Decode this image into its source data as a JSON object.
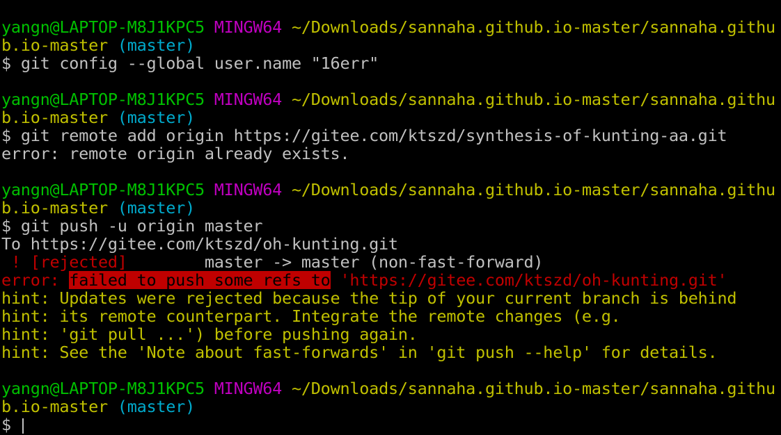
{
  "terminal": {
    "sessions": [
      {
        "user": "yangn@LAPTOP-M8J1KPC5",
        "system": "MINGW64",
        "path_part1": "~/Downloads/sannaha.github.io-master/sannaha.githu",
        "path_part2": "b.io-master",
        "branch": "(master)",
        "prompt": "$",
        "command": "git config --global user.name \"16err\""
      },
      {
        "user": "yangn@LAPTOP-M8J1KPC5",
        "system": "MINGW64",
        "path_part1": "~/Downloads/sannaha.github.io-master/sannaha.githu",
        "path_part2": "b.io-master",
        "branch": "(master)",
        "prompt": "$",
        "command": "git remote add origin https://gitee.com/ktszd/synthesis-of-kunting-aa.git",
        "output": "error: remote origin already exists."
      },
      {
        "user": "yangn@LAPTOP-M8J1KPC5",
        "system": "MINGW64",
        "path_part1": "~/Downloads/sannaha.github.io-master/sannaha.githu",
        "path_part2": "b.io-master",
        "branch": "(master)",
        "prompt": "$",
        "command": "git push -u origin master",
        "output_to": "To https://gitee.com/ktszd/oh-kunting.git",
        "rejected_marker": " ! [rejected]",
        "rejected_detail": "        master -> master (non-fast-forward)",
        "error_prefix": "error: ",
        "error_highlight": "failed to push some refs to",
        "error_url": " 'https://gitee.com/ktszd/oh-kunting.git'",
        "hints": [
          "hint: Updates were rejected because the tip of your current branch is behind",
          "hint: its remote counterpart. Integrate the remote changes (e.g.",
          "hint: 'git pull ...') before pushing again.",
          "hint: See the 'Note about fast-forwards' in 'git push --help' for details."
        ]
      },
      {
        "user": "yangn@LAPTOP-M8J1KPC5",
        "system": "MINGW64",
        "path_part1": "~/Downloads/sannaha.github.io-master/sannaha.githu",
        "path_part2": "b.io-master",
        "branch": "(master)",
        "prompt": "$"
      }
    ],
    "colors": {
      "background": "#000000",
      "user": "#00c000",
      "system": "#c000c0",
      "path": "#c0c000",
      "branch": "#00aacc",
      "output": "#c0c0c0",
      "error": "#c00000"
    }
  }
}
